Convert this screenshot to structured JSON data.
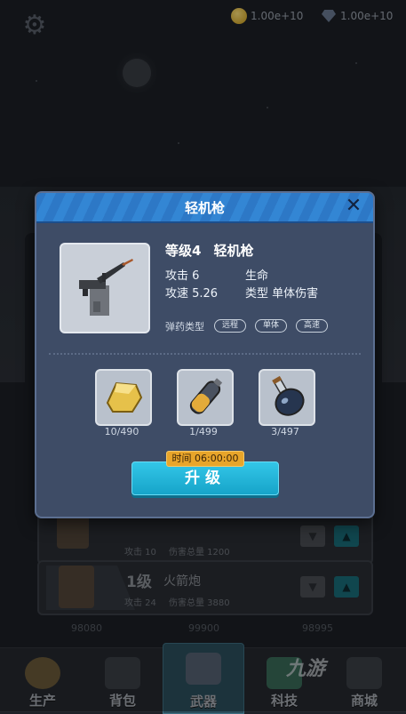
{
  "resources": {
    "gold": "1.00e+10",
    "gems": "1.00e+10"
  },
  "background": {
    "cards": [
      {
        "level": "",
        "name": "",
        "attack_label": "攻击 10",
        "damage_label": "伤害总量 1200"
      },
      {
        "level": "1级",
        "name": "火箭炮",
        "attack_label": "攻击 24",
        "damage_label": "伤害总量 3880"
      }
    ],
    "bottom_values": [
      "98080",
      "99900",
      "98995"
    ]
  },
  "nav": {
    "items": [
      "生产",
      "背包",
      "武器",
      "科技",
      "商城"
    ],
    "active": "武器"
  },
  "watermark": "九游",
  "dialog": {
    "title": "轻机枪",
    "level": "等级4",
    "weapon_name": "轻机枪",
    "attack": "攻击 6",
    "life": "生命",
    "attack_speed": "攻速 5.26",
    "type": "类型 单体伤害",
    "ammo_label": "弹药类型",
    "tags": [
      "远程",
      "单体",
      "高速"
    ],
    "materials": [
      {
        "icon": "gold-ore-icon",
        "count": "10/490"
      },
      {
        "icon": "gas-canister-icon",
        "count": "1/499"
      },
      {
        "icon": "potion-flask-icon",
        "count": "3/497"
      }
    ],
    "timer": "时间 06:00:00",
    "upgrade_label": "升级"
  }
}
